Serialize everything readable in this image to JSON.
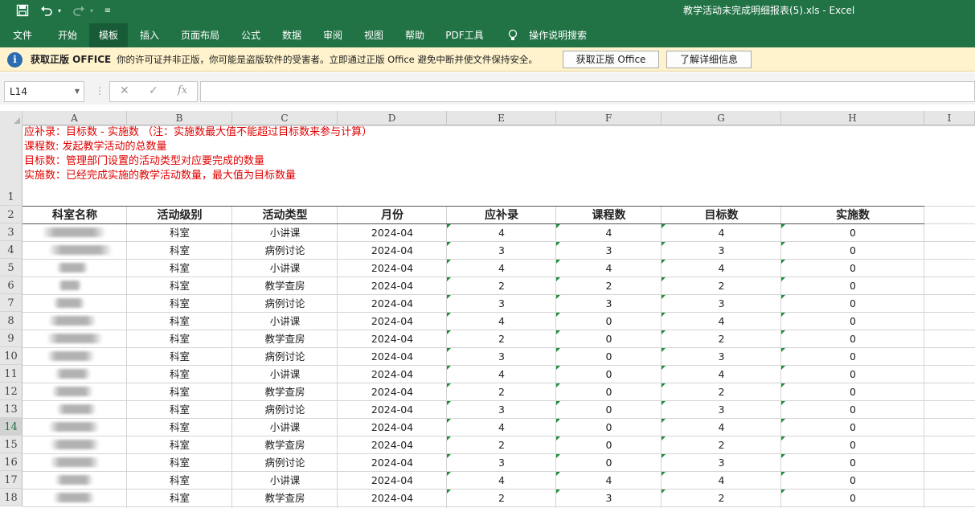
{
  "title_bar": {
    "title": "教学活动未完成明细报表(5).xls  -  Excel",
    "save_icon": "save-icon",
    "undo_icon": "undo-icon",
    "redo_icon": "redo-icon",
    "customize_icon": "customize-icon"
  },
  "ribbon": {
    "tabs": [
      "文件",
      "开始",
      "模板",
      "插入",
      "页面布局",
      "公式",
      "数据",
      "审阅",
      "视图",
      "帮助",
      "PDF工具"
    ],
    "active_tab": "模板",
    "tell_me": "操作说明搜索",
    "bulb_icon": "lightbulb-icon"
  },
  "message_bar": {
    "title": "获取正版 OFFICE",
    "text": "你的许可证并非正版，你可能是盗版软件的受害者。立即通过正版 Office 避免中断并使文件保持安全。",
    "btn_get": "获取正版 Office",
    "btn_more": "了解详细信息"
  },
  "formula_bar": {
    "name_box": "L14",
    "formula": ""
  },
  "columns": [
    "A",
    "B",
    "C",
    "D",
    "E",
    "F",
    "G",
    "H",
    "I"
  ],
  "selected_row": "14",
  "notes": [
    "应补录：目标数  - 实施数 （注：实施数最大值不能超过目标数来参与计算）",
    "课程数:     发起教学活动的总数量",
    "目标数：管理部门设置的活动类型对应要完成的数量",
    "实施数：已经完成实施的教学活动数量，最大值为目标数量"
  ],
  "table": {
    "headers": [
      "科室名称",
      "活动级别",
      "活动类型",
      "月份",
      "应补录",
      "课程数",
      "目标数",
      "实施数"
    ],
    "rows": [
      {
        "r": "3",
        "level": "科室",
        "type": "小讲课",
        "month": "2024-04",
        "fill": "4",
        "courses": "4",
        "target": "4",
        "done": "0"
      },
      {
        "r": "4",
        "level": "科室",
        "type": "病例讨论",
        "month": "2024-04",
        "fill": "3",
        "courses": "3",
        "target": "3",
        "done": "0"
      },
      {
        "r": "5",
        "level": "科室",
        "type": "小讲课",
        "month": "2024-04",
        "fill": "4",
        "courses": "4",
        "target": "4",
        "done": "0"
      },
      {
        "r": "6",
        "level": "科室",
        "type": "教学查房",
        "month": "2024-04",
        "fill": "2",
        "courses": "2",
        "target": "2",
        "done": "0"
      },
      {
        "r": "7",
        "level": "科室",
        "type": "病例讨论",
        "month": "2024-04",
        "fill": "3",
        "courses": "3",
        "target": "3",
        "done": "0"
      },
      {
        "r": "8",
        "level": "科室",
        "type": "小讲课",
        "month": "2024-04",
        "fill": "4",
        "courses": "0",
        "target": "4",
        "done": "0"
      },
      {
        "r": "9",
        "level": "科室",
        "type": "教学查房",
        "month": "2024-04",
        "fill": "2",
        "courses": "0",
        "target": "2",
        "done": "0"
      },
      {
        "r": "10",
        "level": "科室",
        "type": "病例讨论",
        "month": "2024-04",
        "fill": "3",
        "courses": "0",
        "target": "3",
        "done": "0"
      },
      {
        "r": "11",
        "level": "科室",
        "type": "小讲课",
        "month": "2024-04",
        "fill": "4",
        "courses": "0",
        "target": "4",
        "done": "0"
      },
      {
        "r": "12",
        "level": "科室",
        "type": "教学查房",
        "month": "2024-04",
        "fill": "2",
        "courses": "0",
        "target": "2",
        "done": "0"
      },
      {
        "r": "13",
        "level": "科室",
        "type": "病例讨论",
        "month": "2024-04",
        "fill": "3",
        "courses": "0",
        "target": "3",
        "done": "0"
      },
      {
        "r": "14",
        "level": "科室",
        "type": "小讲课",
        "month": "2024-04",
        "fill": "4",
        "courses": "0",
        "target": "4",
        "done": "0"
      },
      {
        "r": "15",
        "level": "科室",
        "type": "教学查房",
        "month": "2024-04",
        "fill": "2",
        "courses": "0",
        "target": "2",
        "done": "0"
      },
      {
        "r": "16",
        "level": "科室",
        "type": "病例讨论",
        "month": "2024-04",
        "fill": "3",
        "courses": "0",
        "target": "3",
        "done": "0"
      },
      {
        "r": "17",
        "level": "科室",
        "type": "小讲课",
        "month": "2024-04",
        "fill": "4",
        "courses": "4",
        "target": "4",
        "done": "0"
      },
      {
        "r": "18",
        "level": "科室",
        "type": "教学查房",
        "month": "2024-04",
        "fill": "2",
        "courses": "3",
        "target": "2",
        "done": "0"
      }
    ]
  },
  "colors": {
    "excel_green": "#217346",
    "note_red": "#e00000",
    "message_bar": "#fff3cd"
  }
}
